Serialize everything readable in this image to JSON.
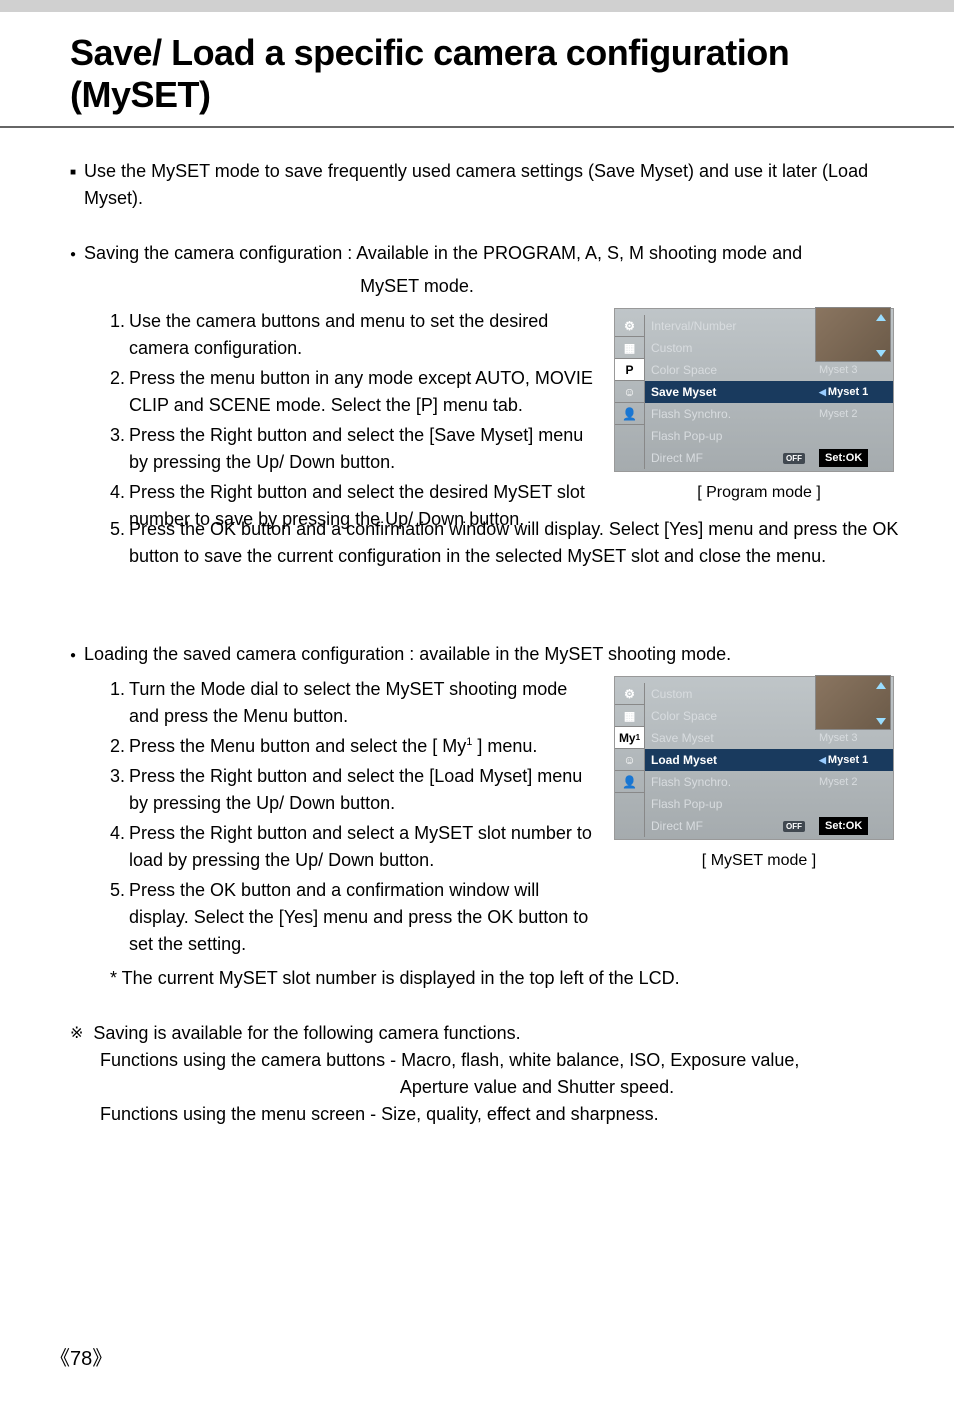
{
  "title": "Save/ Load a specific camera configuration (MySET)",
  "intro": "Use the MySET mode to save frequently used camera settings (Save Myset) and use it later (Load Myset).",
  "saving_heading": "Saving the camera configuration : Available in the PROGRAM, A, S, M shooting mode and",
  "saving_heading_line2": "MySET mode.",
  "saving_steps": [
    {
      "n": "1.",
      "t": "Use the camera buttons and menu to set the desired camera configuration."
    },
    {
      "n": "2.",
      "t": "Press the menu button in any mode except AUTO, MOVIE CLIP and SCENE mode. Select the [P] menu tab."
    },
    {
      "n": "3.",
      "t": "Press the Right button and select the [Save Myset] menu by pressing the Up/ Down button."
    },
    {
      "n": "4.",
      "t": "Press the Right button and select the desired MySET slot number to save by pressing the Up/ Down button."
    },
    {
      "n": "5.",
      "t": "Press the OK button and a confirmation window will display. Select [Yes] menu and press the OK button to save the current configuration in the selected MySET slot and close the menu."
    }
  ],
  "loading_heading": "Loading the saved camera configuration : available in the MySET shooting mode.",
  "loading_steps": [
    {
      "n": "1.",
      "t": "Turn the Mode dial to select the MySET shooting mode and press the Menu button."
    },
    {
      "n": "2.",
      "t_a": "Press the Menu button and select the [ ",
      "t_b": " ] menu.",
      "icon": "My",
      "iconsup": "1"
    },
    {
      "n": "3.",
      "t": "Press the Right button and select the [Load Myset] menu by pressing the Up/ Down button."
    },
    {
      "n": "4.",
      "t": "Press the Right button and select a MySET slot number to load by pressing the Up/ Down button."
    },
    {
      "n": "5.",
      "t": "Press the OK button and a confirmation window will display. Select the [Yes] menu and press the OK button to set the setting."
    }
  ],
  "loading_note": "* The current MySET slot number is displayed in the top left of the LCD.",
  "saving_extra_heading": "Saving is available for the following camera functions.",
  "saving_extra_line1": "Functions using the camera buttons - Macro, flash, white balance, ISO, Exposure value,",
  "saving_extra_line1b": "Aperture value and Shutter speed.",
  "saving_extra_line2": "Functions using the menu screen - Size, quality, effect and sharpness.",
  "menu1": {
    "tabs": [
      "",
      "",
      "P",
      "",
      ""
    ],
    "selected_tab_index": 2,
    "tab_icons": [
      "sliders",
      "grid",
      "P",
      "portrait",
      "person"
    ],
    "rows": [
      {
        "label": "Interval/Number",
        "value": ""
      },
      {
        "label": "Custom",
        "value": ""
      },
      {
        "label": "Color Space",
        "value": "Myset 3"
      },
      {
        "label": "Save Myset",
        "value": "Myset 1",
        "highlight": true
      },
      {
        "label": "Flash Synchro.",
        "value": "Myset 2"
      },
      {
        "label": "Flash Pop-up",
        "value": ""
      },
      {
        "label": "Direct MF",
        "value": "Set:OK",
        "off": true,
        "setok": true
      }
    ],
    "caption": "[ Program mode ]"
  },
  "menu2": {
    "tabs": [
      "",
      "",
      "My1",
      "",
      ""
    ],
    "selected_tab_index": 2,
    "rows": [
      {
        "label": "Custom",
        "value": ""
      },
      {
        "label": "Color Space",
        "value": ""
      },
      {
        "label": "Save Myset",
        "value": "Myset 3"
      },
      {
        "label": "Load Myset",
        "value": "Myset 1",
        "highlight": true
      },
      {
        "label": "Flash Synchro.",
        "value": "Myset 2"
      },
      {
        "label": "Flash Pop-up",
        "value": ""
      },
      {
        "label": "Direct MF",
        "value": "Set:OK",
        "off": true,
        "setok": true
      }
    ],
    "caption": "[ MySET mode ]"
  },
  "page_number": "《78》"
}
